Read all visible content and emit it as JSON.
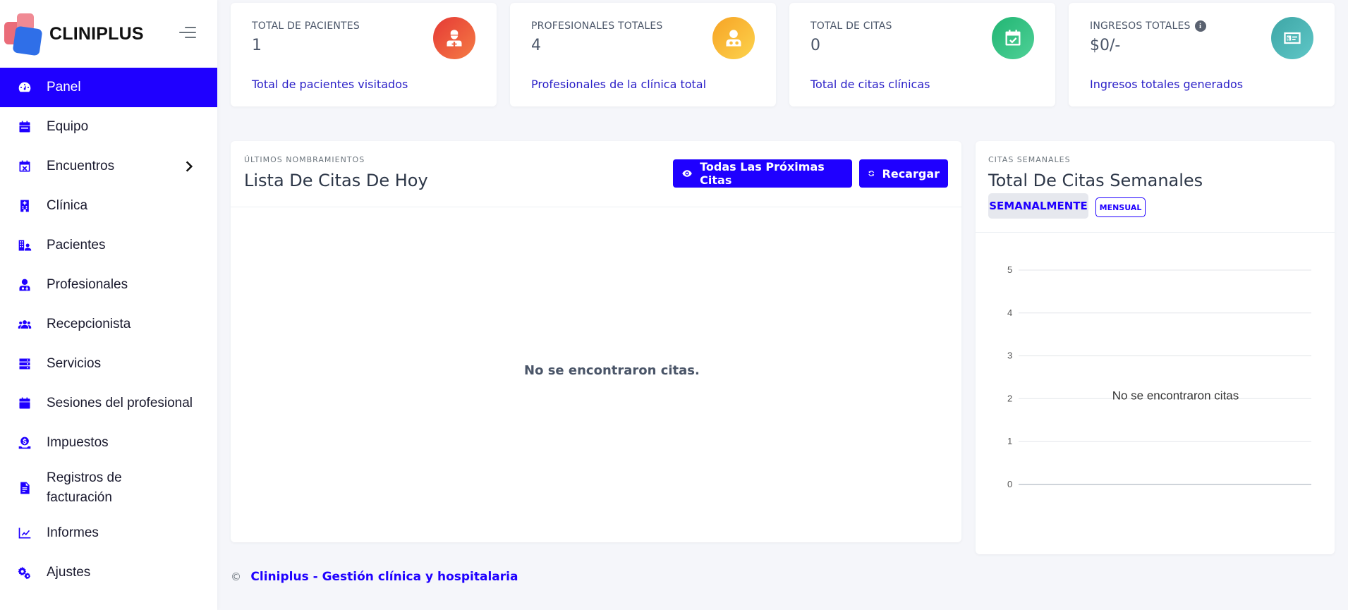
{
  "brand": {
    "name": "CLINIPLUS"
  },
  "sidebar": {
    "items": [
      {
        "label": "Panel",
        "icon": "dashboard-icon",
        "active": true
      },
      {
        "label": "Equipo",
        "icon": "calendar-icon"
      },
      {
        "label": "Encuentros",
        "icon": "calendar-x-icon",
        "has_children": true
      },
      {
        "label": "Clínica",
        "icon": "hospital-icon"
      },
      {
        "label": "Pacientes",
        "icon": "patients-icon"
      },
      {
        "label": "Profesionales",
        "icon": "doctor-icon"
      },
      {
        "label": "Recepcionista",
        "icon": "users-icon"
      },
      {
        "label": "Servicios",
        "icon": "server-icon"
      },
      {
        "label": "Sesiones del profesional",
        "icon": "calendar-icon"
      },
      {
        "label": "Impuestos",
        "icon": "tax-icon"
      },
      {
        "label": "Registros de facturación",
        "icon": "invoice-icon"
      },
      {
        "label": "Informes",
        "icon": "chart-line-icon"
      },
      {
        "label": "Ajustes",
        "icon": "gears-icon"
      }
    ]
  },
  "stats": [
    {
      "title": "TOTAL DE PACIENTES",
      "value": "1",
      "subtitle": "Total de pacientes visitados",
      "icon": "patient-icon",
      "color_from": "#e53935",
      "color_to": "#f57c45"
    },
    {
      "title": "PROFESIONALES TOTALES",
      "value": "4",
      "subtitle": "Profesionales de la clínica total",
      "icon": "doctor-icon",
      "color_from": "#f7a325",
      "color_to": "#fcd34d"
    },
    {
      "title": "TOTAL DE CITAS",
      "value": "0",
      "subtitle": "Total de citas clínicas",
      "icon": "calendar-check-icon",
      "color_from": "#21b573",
      "color_to": "#4fd197"
    },
    {
      "title": "INGRESOS TOTALES",
      "value": "$0/-",
      "subtitle": "Ingresos totales generados",
      "icon": "money-icon",
      "color_from": "#3ea6a6",
      "color_to": "#5fc7c7",
      "has_info": true
    }
  ],
  "appointments": {
    "eyebrow": "ÚLTIMOS NOMBRAMIENTOS",
    "title": "Lista De Citas De Hoy",
    "btn_upcoming": "Todas Las Próximas Citas",
    "btn_reload": "Recargar",
    "empty": "No se encontraron citas."
  },
  "weekly": {
    "eyebrow": "CITAS SEMANALES",
    "title": "Total De Citas Semanales",
    "tab_weekly": "SEMANALMENTE",
    "tab_monthly": "MENSUAL"
  },
  "chart_data": {
    "type": "line",
    "title": "Total De Citas Semanales",
    "series": [],
    "ylim": [
      0,
      5
    ],
    "yticks": [
      "5",
      "4",
      "3",
      "2",
      "1",
      "0"
    ],
    "grid": true,
    "empty_message": "No se encontraron citas"
  },
  "footer": {
    "copyright": "©",
    "link": "Cliniplus - Gestión clínica y hospitalaria"
  }
}
